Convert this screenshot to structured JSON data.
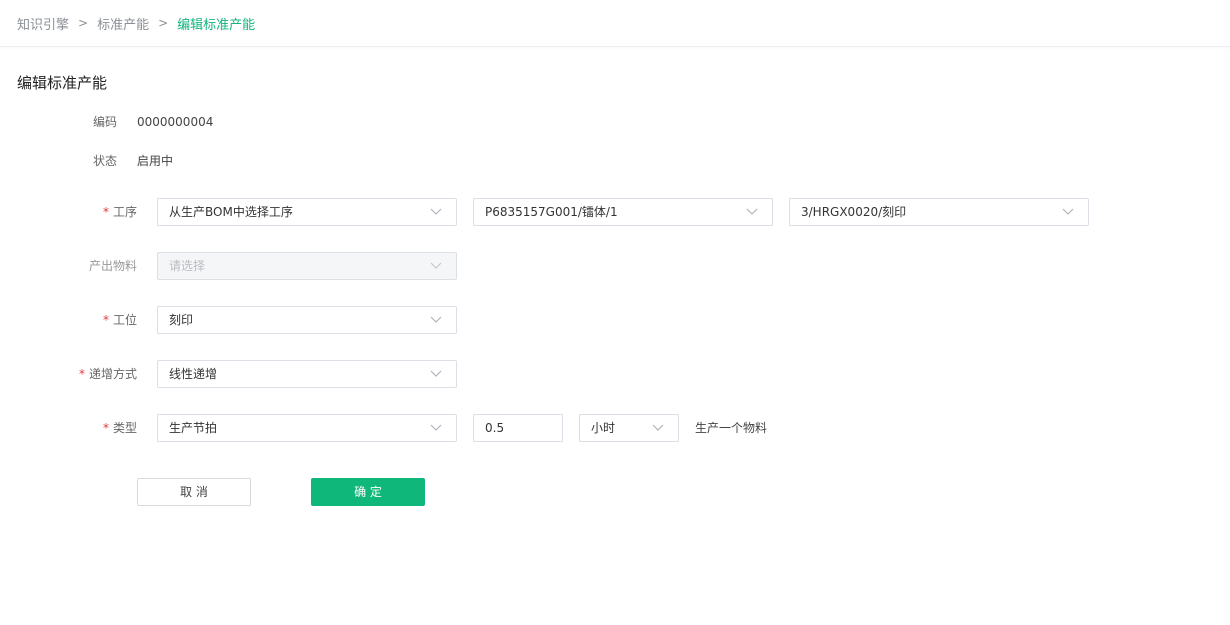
{
  "breadcrumb": {
    "items": [
      "知识引擎",
      "标准产能",
      "编辑标准产能"
    ],
    "separator": ">"
  },
  "page": {
    "title": "编辑标准产能"
  },
  "form": {
    "code": {
      "label": "编码",
      "value": "0000000004"
    },
    "status": {
      "label": "状态",
      "value": "启用中"
    },
    "process": {
      "label": "工序",
      "required": true,
      "source_select": "从生产BOM中选择工序",
      "bom_select": "P6835157G001/镭体/1",
      "process_select": "3/HRGX0020/刻印"
    },
    "output_material": {
      "label": "产出物料",
      "placeholder": "请选择",
      "disabled": true
    },
    "workstation": {
      "label": "工位",
      "required": true,
      "value": "刻印"
    },
    "increment_mode": {
      "label": "递增方式",
      "required": true,
      "value": "线性递增"
    },
    "type": {
      "label": "类型",
      "required": true,
      "value": "生产节拍",
      "amount": "0.5",
      "unit": "小时",
      "suffix": "生产一个物料"
    }
  },
  "buttons": {
    "cancel": "取 消",
    "confirm": "确 定"
  },
  "colors": {
    "accent": "#0fb77b",
    "required": "#e4393c",
    "border": "#dcdfe6"
  },
  "icons": {
    "dropdown": "chevron-down-icon"
  }
}
